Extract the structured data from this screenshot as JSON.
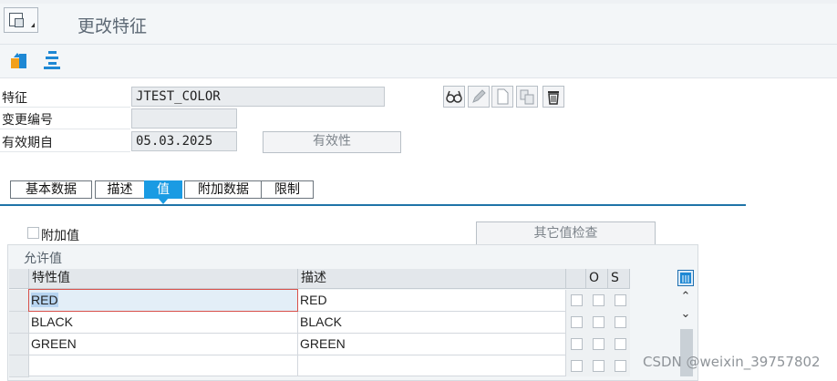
{
  "header": {
    "title": "更改特征"
  },
  "form": {
    "characteristic_label": "特征",
    "characteristic_value": "JTEST_COLOR",
    "change_number_label": "变更编号",
    "change_number_value": "",
    "valid_from_label": "有效期自",
    "valid_from_value": "05.03.2025",
    "validity_button": "有效性"
  },
  "tabs": [
    {
      "label": "基本数据",
      "active": false
    },
    {
      "label": "描述",
      "active": false
    },
    {
      "label": "值",
      "active": true
    },
    {
      "label": "附加数据",
      "active": false
    },
    {
      "label": "限制",
      "active": false
    }
  ],
  "values_section": {
    "additional_values_label": "附加值",
    "additional_values_checked": false,
    "other_value_check_button": "其它值检查",
    "group_title": "允许值",
    "columns": [
      "特性值",
      "描述",
      "",
      "O",
      "S"
    ],
    "rows": [
      {
        "value": "RED",
        "description": "RED"
      },
      {
        "value": "BLACK",
        "description": "BLACK"
      },
      {
        "value": "GREEN",
        "description": "GREEN"
      },
      {
        "value": "",
        "description": ""
      }
    ]
  },
  "watermark": "CSDN @weixin_39757802",
  "colors": {
    "accent": "#1a9be3",
    "tab_line": "#1f74a8"
  }
}
